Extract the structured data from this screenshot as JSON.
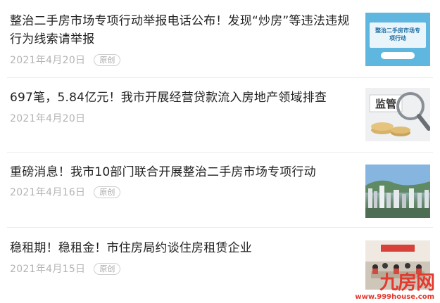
{
  "articles": [
    {
      "title": "整治二手房市场专项行动举报电话公布！发现“炒房”等违法违规行为线索请举报",
      "date": "2021年4月20日",
      "badge": "原创",
      "thumb_text": "整治二手房市场专项行动"
    },
    {
      "title": "697笔，5.84亿元！我市开展经营贷款流入房地产领域排查",
      "date": "2021年4月20日",
      "badge": "原创",
      "thumb_text": "监管"
    },
    {
      "title": "重磅消息！我市10部门联合开展整治二手房市场专项行动",
      "date": "2021年4月16日",
      "badge": "原创"
    },
    {
      "title": "稳租期！稳租金！市住房局约谈住房租赁企业",
      "date": "2021年4月15日",
      "badge": "原创"
    }
  ],
  "watermark": {
    "brand": "九房网",
    "url": "www.999house.com"
  },
  "colors": {
    "title": "#222222",
    "meta": "#b4b4b4",
    "watermark": "#e23a2f"
  }
}
